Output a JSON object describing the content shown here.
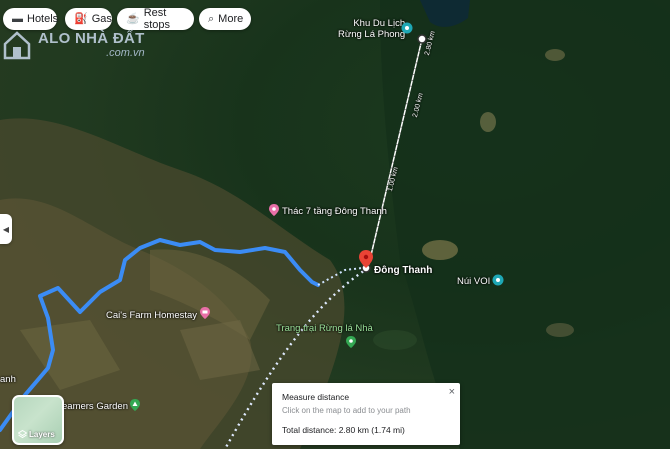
{
  "filters": [
    {
      "icon": "bed-icon",
      "glyph": "▬",
      "label": "Hotels"
    },
    {
      "icon": "gas-icon",
      "glyph": "⛽",
      "label": "Gas"
    },
    {
      "icon": "rest-stop-icon",
      "glyph": "☕",
      "label": "Rest stops"
    },
    {
      "icon": "search-icon",
      "glyph": "⌕",
      "label": "More"
    }
  ],
  "watermark": {
    "brand": "ALO NHÀ ĐẤT",
    "domain": ".com.vn"
  },
  "places": {
    "rung_la_phong_line1": "Khu Du Lịch",
    "rung_la_phong_line2": "Rừng Lá Phong",
    "thac_7_tang": "Thác 7 tầng Đông Thanh",
    "dong_thanh": "Đông Thanh",
    "nui_voi": "Núi VOI",
    "cais_farm": "Cai's Farm Homestay",
    "trang_trai": "Trang trại Rừng lá Nhà",
    "dreamers_garden": "eamers Garden",
    "anh_fragment": "anh"
  },
  "distance_markers": [
    "2.80 km",
    "2.00 km",
    "1.00 km"
  ],
  "layers": {
    "label": "Layers"
  },
  "measure": {
    "title": "Measure distance",
    "hint": "Click on the map to add to your path",
    "total": "Total distance: 2.80 km (1.74 mi)",
    "close": "×"
  },
  "colors": {
    "route": "#3b8cf5",
    "pin": "#ea4335",
    "measure_line": "#ffffff",
    "poi_pink": "#e86fa7",
    "poi_teal": "#1ea7b5",
    "poi_green": "#34a853"
  },
  "side_toggle": "◀"
}
